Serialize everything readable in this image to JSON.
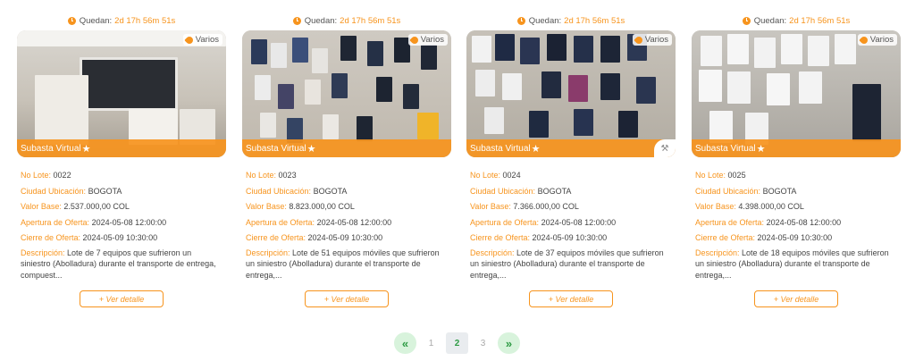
{
  "cards": [
    {
      "timer_label": "Quedan:",
      "timer_value": "2d 17h 56m 51s",
      "tag": "Varios",
      "band": "Subasta Virtual",
      "lote_k": "No Lote:",
      "lote_v": "0022",
      "ciudad_k": "Ciudad Ubicación:",
      "ciudad_v": "BOGOTA",
      "valor_k": "Valor Base:",
      "valor_v": "2.537.000,00 COL",
      "apertura_k": "Apertura de Oferta:",
      "apertura_v": "2024-05-08 12:00:00",
      "cierre_k": "Cierre de Oferta:",
      "cierre_v": "2024-05-09 10:30:00",
      "desc_k": "Descripción:",
      "desc_v": "Lote de 7 equipos que sufrieron un siniestro (Abolladura) durante el transporte de entrega, compuest...",
      "button": "+ Ver detalle"
    },
    {
      "timer_label": "Quedan:",
      "timer_value": "2d 17h 56m 51s",
      "tag": "Varios",
      "band": "Subasta Virtual",
      "lote_k": "No Lote:",
      "lote_v": "0023",
      "ciudad_k": "Ciudad Ubicación:",
      "ciudad_v": "BOGOTA",
      "valor_k": "Valor Base:",
      "valor_v": "8.823.000,00 COL",
      "apertura_k": "Apertura de Oferta:",
      "apertura_v": "2024-05-08 12:00:00",
      "cierre_k": "Cierre de Oferta:",
      "cierre_v": "2024-05-09 10:30:00",
      "desc_k": "Descripción:",
      "desc_v": "Lote de 51 equipos móviles que sufrieron un siniestro (Abolladura) durante el transporte de entrega,...",
      "button": "+ Ver detalle"
    },
    {
      "timer_label": "Quedan:",
      "timer_value": "2d 17h 56m 51s",
      "tag": "Varios",
      "band": "Subasta Virtual",
      "lote_k": "No Lote:",
      "lote_v": "0024",
      "ciudad_k": "Ciudad Ubicación:",
      "ciudad_v": "BOGOTA",
      "valor_k": "Valor Base:",
      "valor_v": "7.366.000,00 COL",
      "apertura_k": "Apertura de Oferta:",
      "apertura_v": "2024-05-08 12:00:00",
      "cierre_k": "Cierre de Oferta:",
      "cierre_v": "2024-05-09 10:30:00",
      "desc_k": "Descripción:",
      "desc_v": "Lote de 37 equipos móviles que sufrieron un siniestro (Abolladura) durante el transporte de entrega,...",
      "button": "+ Ver detalle"
    },
    {
      "timer_label": "Quedan:",
      "timer_value": "2d 17h 56m 51s",
      "tag": "Varios",
      "band": "Subasta Virtual",
      "lote_k": "No Lote:",
      "lote_v": "0025",
      "ciudad_k": "Ciudad Ubicación:",
      "ciudad_v": "BOGOTA",
      "valor_k": "Valor Base:",
      "valor_v": "4.398.000,00 COL",
      "apertura_k": "Apertura de Oferta:",
      "apertura_v": "2024-05-08 12:00:00",
      "cierre_k": "Cierre de Oferta:",
      "cierre_v": "2024-05-09 10:30:00",
      "desc_k": "Descripción:",
      "desc_v": "Lote de 18 equipos móviles que sufrieron un siniestro (Abolladura) durante el transporte de entrega,...",
      "button": "+ Ver detalle"
    }
  ],
  "pagination": {
    "prev_icon": "«",
    "pages": [
      "1",
      "2",
      "3"
    ],
    "current": "2",
    "next_icon": "»"
  },
  "colors": {
    "accent": "#f7941d",
    "pager_green": "#2e9b44",
    "pager_bg": "#d8f3dc"
  },
  "icons": [
    "clock-icon",
    "tag-icon",
    "star-icon",
    "hammer-icon",
    "double-chevron-left-icon",
    "double-chevron-right-icon"
  ]
}
